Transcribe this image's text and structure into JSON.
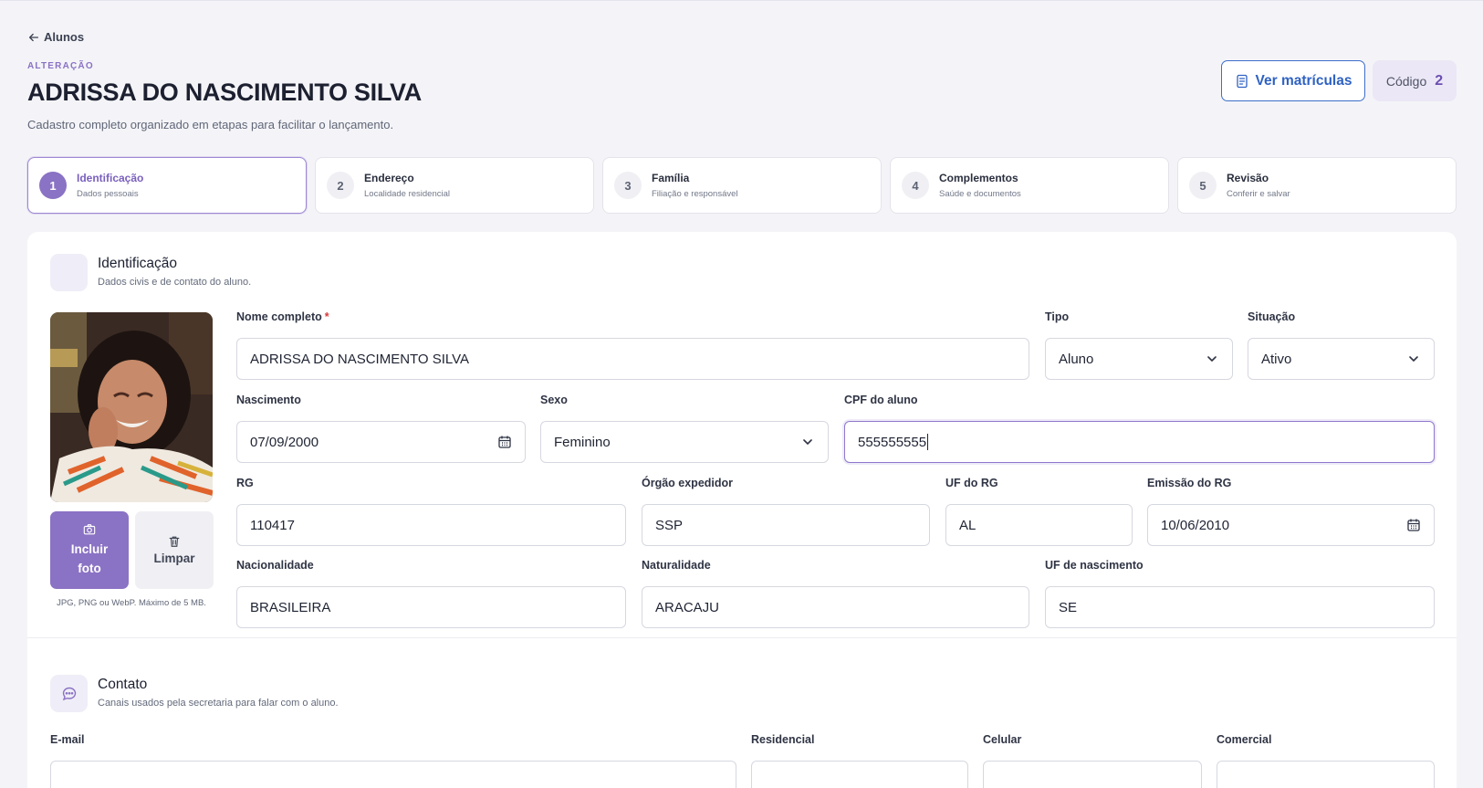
{
  "nav": {
    "back_label": "Alunos"
  },
  "header": {
    "kicker": "ALTERAÇÃO",
    "title": "ADRISSA DO NASCIMENTO SILVA",
    "subtitle": "Cadastro completo organizado em etapas para facilitar o lançamento.",
    "view_enrollments_label": "Ver matrículas",
    "code_label": "Código",
    "code_value": "2"
  },
  "steps": [
    {
      "num": "1",
      "title": "Identificação",
      "subtitle": "Dados pessoais",
      "active": true
    },
    {
      "num": "2",
      "title": "Endereço",
      "subtitle": "Localidade residencial",
      "active": false
    },
    {
      "num": "3",
      "title": "Família",
      "subtitle": "Filiação e responsável",
      "active": false
    },
    {
      "num": "4",
      "title": "Complementos",
      "subtitle": "Saúde e documentos",
      "active": false
    },
    {
      "num": "5",
      "title": "Revisão",
      "subtitle": "Conferir e salvar",
      "active": false
    }
  ],
  "identification": {
    "title": "Identificação",
    "subtitle": "Dados civis e de contato do aluno.",
    "photo_upload_label_1": "Incluir",
    "photo_upload_label_2": "foto",
    "photo_clear_label": "Limpar",
    "photo_hint": "JPG, PNG ou WebP. Máximo de 5 MB.",
    "fields": {
      "nome_label": "Nome completo",
      "nome_required": "*",
      "nome_value": "ADRISSA DO NASCIMENTO SILVA",
      "tipo_label": "Tipo",
      "tipo_value": "Aluno",
      "situacao_label": "Situação",
      "situacao_value": "Ativo",
      "nascimento_label": "Nascimento",
      "nascimento_value": "07/09/2000",
      "sexo_label": "Sexo",
      "sexo_value": "Feminino",
      "cpf_label": "CPF do aluno",
      "cpf_value": "555555555",
      "rg_label": "RG",
      "rg_value": "110417",
      "orgao_label": "Órgão expedidor",
      "orgao_value": "SSP",
      "uf_rg_label": "UF do RG",
      "uf_rg_value": "AL",
      "emissao_label": "Emissão do RG",
      "emissao_value": "10/06/2010",
      "nacionalidade_label": "Nacionalidade",
      "nacionalidade_value": "BRASILEIRA",
      "naturalidade_label": "Naturalidade",
      "naturalidade_value": "ARACAJU",
      "uf_nasc_label": "UF de nascimento",
      "uf_nasc_value": "SE"
    }
  },
  "contact": {
    "title": "Contato",
    "subtitle": "Canais usados pela secretaria para falar com o aluno.",
    "email_label": "E-mail",
    "residencial_label": "Residencial",
    "celular_label": "Celular",
    "comercial_label": "Comercial"
  },
  "colors": {
    "accent": "#8a72c4",
    "link": "#2f62c2",
    "required": "#d83a3a"
  }
}
